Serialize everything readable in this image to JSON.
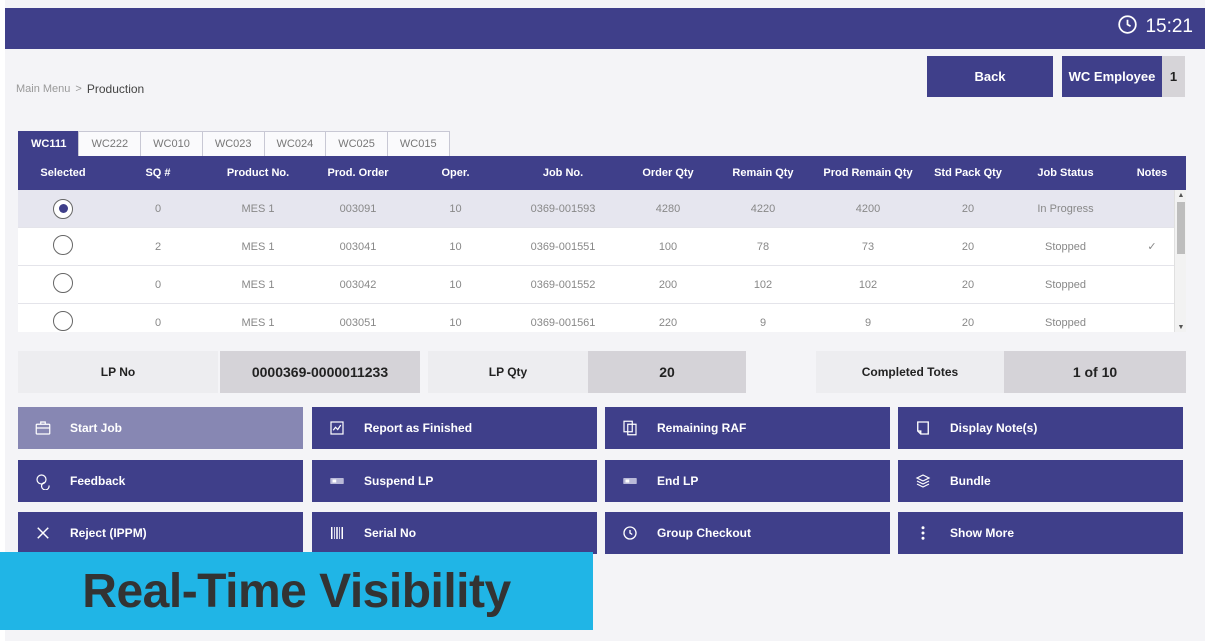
{
  "header": {
    "time": "15:21"
  },
  "breadcrumb": {
    "root": "Main Menu",
    "separator": ">",
    "current": "Production"
  },
  "top_buttons": {
    "back": "Back",
    "employee": "WC Employee",
    "employee_count": "1"
  },
  "tabs": [
    {
      "label": "WC111",
      "active": true
    },
    {
      "label": "WC222",
      "active": false
    },
    {
      "label": "WC010",
      "active": false
    },
    {
      "label": "WC023",
      "active": false
    },
    {
      "label": "WC024",
      "active": false
    },
    {
      "label": "WC025",
      "active": false
    },
    {
      "label": "WC015",
      "active": false
    }
  ],
  "table": {
    "columns": [
      "Selected",
      "SQ #",
      "Product No.",
      "Prod. Order",
      "Oper.",
      "Job No.",
      "Order Qty",
      "Remain Qty",
      "Prod Remain Qty",
      "Std Pack Qty",
      "Job Status",
      "Notes"
    ],
    "rows": [
      {
        "selected": true,
        "sq": "0",
        "product": "MES 1",
        "prod_order": "003091",
        "oper": "10",
        "job_no": "0369-001593",
        "order_qty": "4280",
        "remain_qty": "4220",
        "prod_remain_qty": "4200",
        "std_pack_qty": "20",
        "status": "In Progress",
        "notes": ""
      },
      {
        "selected": false,
        "sq": "2",
        "product": "MES 1",
        "prod_order": "003041",
        "oper": "10",
        "job_no": "0369-001551",
        "order_qty": "100",
        "remain_qty": "78",
        "prod_remain_qty": "73",
        "std_pack_qty": "20",
        "status": "Stopped",
        "notes": "✓"
      },
      {
        "selected": false,
        "sq": "0",
        "product": "MES 1",
        "prod_order": "003042",
        "oper": "10",
        "job_no": "0369-001552",
        "order_qty": "200",
        "remain_qty": "102",
        "prod_remain_qty": "102",
        "std_pack_qty": "20",
        "status": "Stopped",
        "notes": ""
      },
      {
        "selected": false,
        "sq": "0",
        "product": "MES 1",
        "prod_order": "003051",
        "oper": "10",
        "job_no": "0369-001561",
        "order_qty": "220",
        "remain_qty": "9",
        "prod_remain_qty": "9",
        "std_pack_qty": "20",
        "status": "Stopped",
        "notes": ""
      }
    ]
  },
  "info": {
    "lp_no_label": "LP No",
    "lp_no_value": "0000369-0000011233",
    "lp_qty_label": "LP Qty",
    "lp_qty_value": "20",
    "completed_label": "Completed Totes",
    "completed_value": "1 of 10"
  },
  "actions": {
    "start_job": "Start Job",
    "report_finished": "Report as Finished",
    "remaining_raf": "Remaining RAF",
    "display_notes": "Display Note(s)",
    "feedback": "Feedback",
    "suspend_lp": "Suspend LP",
    "end_lp": "End LP",
    "bundle": "Bundle",
    "reject": "Reject (IPPM)",
    "serial_no": "Serial No",
    "group_checkout": "Group Checkout",
    "show_more": "Show More"
  },
  "caption": "Real-Time Visibility",
  "colors": {
    "primary": "#3f3f8a",
    "disabled": "#8787b3",
    "caption_bg": "#20b5e6"
  }
}
